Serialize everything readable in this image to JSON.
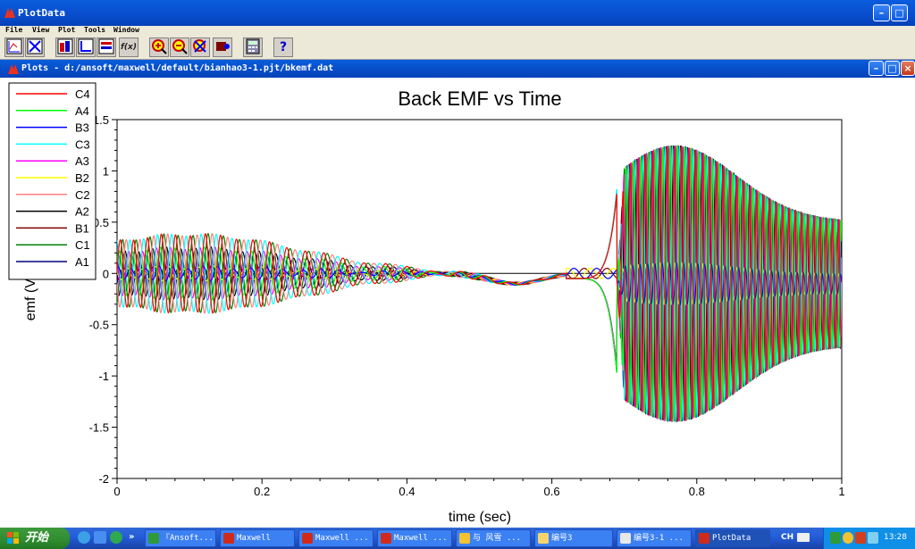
{
  "window": {
    "title": "PlotData",
    "menu": [
      "File",
      "View",
      "Plot",
      "Tools",
      "Window"
    ]
  },
  "document": {
    "title": "Plots - d:/ansoft/maxwell/default/bianhao3-1.pjt/bkemf.dat"
  },
  "toolbar": {
    "buttons": [
      "new-plot",
      "delete-plot",
      "plot-settings",
      "axis-settings",
      "data-settings",
      "function",
      "zoom-in",
      "zoom-out",
      "zoom-fit",
      "record",
      "calculator",
      "help"
    ]
  },
  "chart_data": {
    "type": "line",
    "title": "Back EMF vs Time",
    "xlabel": "time (sec)",
    "ylabel": "emf (V)",
    "xlim": [
      0,
      1
    ],
    "ylim": [
      -2,
      1.5
    ],
    "x_ticks": [
      "0",
      "0.2",
      "0.4",
      "0.6",
      "0.8",
      "1"
    ],
    "y_ticks": [
      "-2",
      "-1.5",
      "-1",
      "-0.5",
      "0",
      "0.5",
      "1",
      "1.5"
    ],
    "grid": false,
    "legend_position": "top-left",
    "series": [
      {
        "name": "C4",
        "color": "#ff0000"
      },
      {
        "name": "A4",
        "color": "#00ff00"
      },
      {
        "name": "B3",
        "color": "#0000ff"
      },
      {
        "name": "C3",
        "color": "#00ffff"
      },
      {
        "name": "A3",
        "color": "#ff00ff"
      },
      {
        "name": "B2",
        "color": "#ffff00"
      },
      {
        "name": "C2",
        "color": "#ff8080"
      },
      {
        "name": "A2",
        "color": "#000000"
      },
      {
        "name": "B1",
        "color": "#800000"
      },
      {
        "name": "C1",
        "color": "#008000"
      },
      {
        "name": "A1",
        "color": "#000080"
      }
    ]
  },
  "taskbar": {
    "start_label": "开始",
    "tasks": [
      "『Ansoft...",
      "Maxwell",
      "Maxwell ...",
      "Maxwell ...",
      "与 风雪 ...",
      "编号3",
      "编号3-1 ...",
      "PlotData"
    ],
    "language": "CH",
    "clock": "13:28"
  }
}
